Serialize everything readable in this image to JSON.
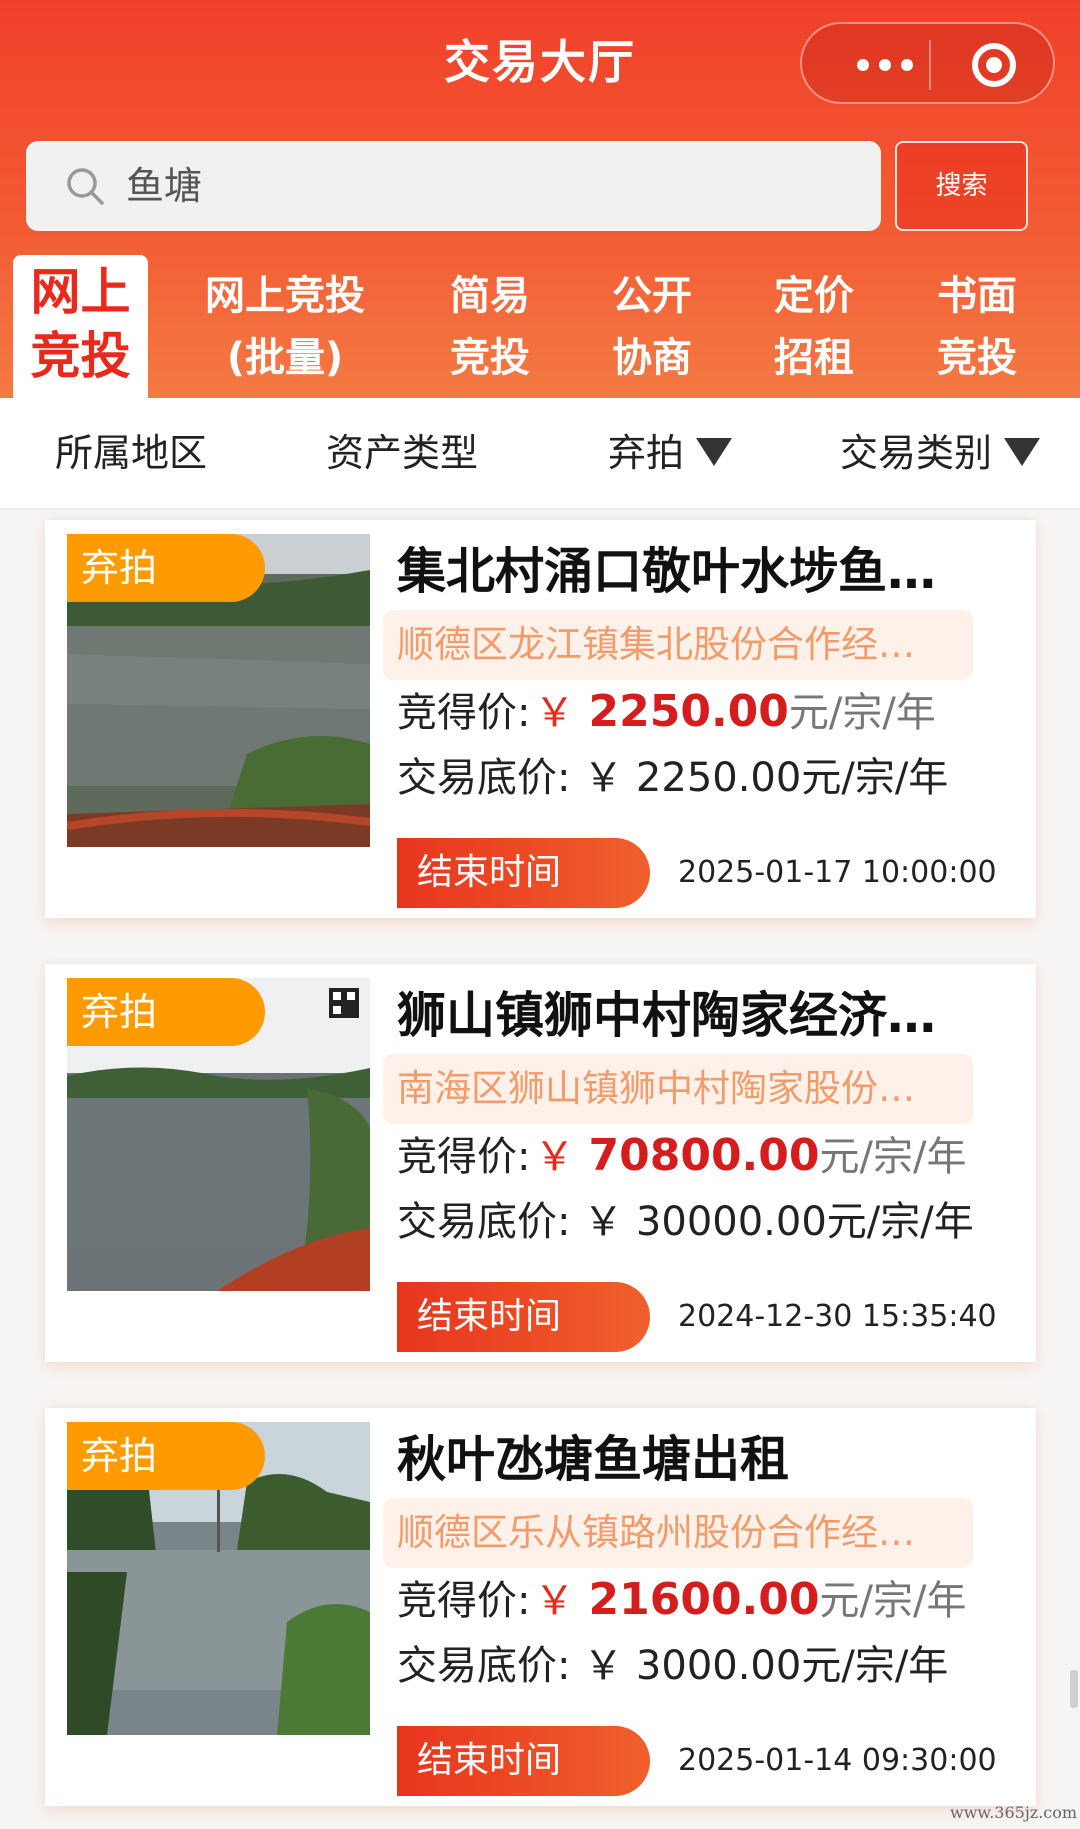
{
  "header": {
    "title": "交易大厅",
    "more_icon": "more-dots-icon",
    "close_icon": "target-circle-icon"
  },
  "search": {
    "value": "鱼塘",
    "button_label": "搜索"
  },
  "tabs": [
    {
      "line1": "网上",
      "line2": "竞投",
      "active": true
    },
    {
      "line1": "网上竞投",
      "line2": "(批量)",
      "active": false
    },
    {
      "line1": "简易",
      "line2": "竞投",
      "active": false
    },
    {
      "line1": "公开",
      "line2": "协商",
      "active": false
    },
    {
      "line1": "定价",
      "line2": "招租",
      "active": false
    },
    {
      "line1": "书面",
      "line2": "竞投",
      "active": false
    }
  ],
  "filters": [
    {
      "label": "所属地区",
      "dropdown": false
    },
    {
      "label": "资产类型",
      "dropdown": false
    },
    {
      "label": "弃拍",
      "dropdown": true
    },
    {
      "label": "交易类别",
      "dropdown": true
    }
  ],
  "labels": {
    "win_price": "竞得价:",
    "base_price": "交易底价:",
    "yen": "￥",
    "unit": "元/宗/年",
    "end_button": "结束时间"
  },
  "listings": [
    {
      "badge": "弃拍",
      "title": "集北村涌口敬叶水埗鱼…",
      "org": "顺德区龙江镇集北股份合作经…",
      "win_price": "2250.00",
      "base_price": "2250.00",
      "end_time": "2025-01-17 10:00:00"
    },
    {
      "badge": "弃拍",
      "title": "狮山镇狮中村陶家经济…",
      "org": "南海区狮山镇狮中村陶家股份…",
      "win_price": "70800.00",
      "base_price": "30000.00",
      "end_time": "2024-12-30 15:35:40"
    },
    {
      "badge": "弃拍",
      "title": "秋叶氹塘鱼塘出租",
      "org": "顺德区乐从镇路州股份合作经…",
      "win_price": "21600.00",
      "base_price": "3000.00",
      "end_time": "2025-01-14 09:30:00"
    }
  ],
  "watermark": "www.365jz.com",
  "colors": {
    "brand_red": "#e8291b",
    "badge_orange": "#ff9a00",
    "org_text": "#f29c6b"
  }
}
